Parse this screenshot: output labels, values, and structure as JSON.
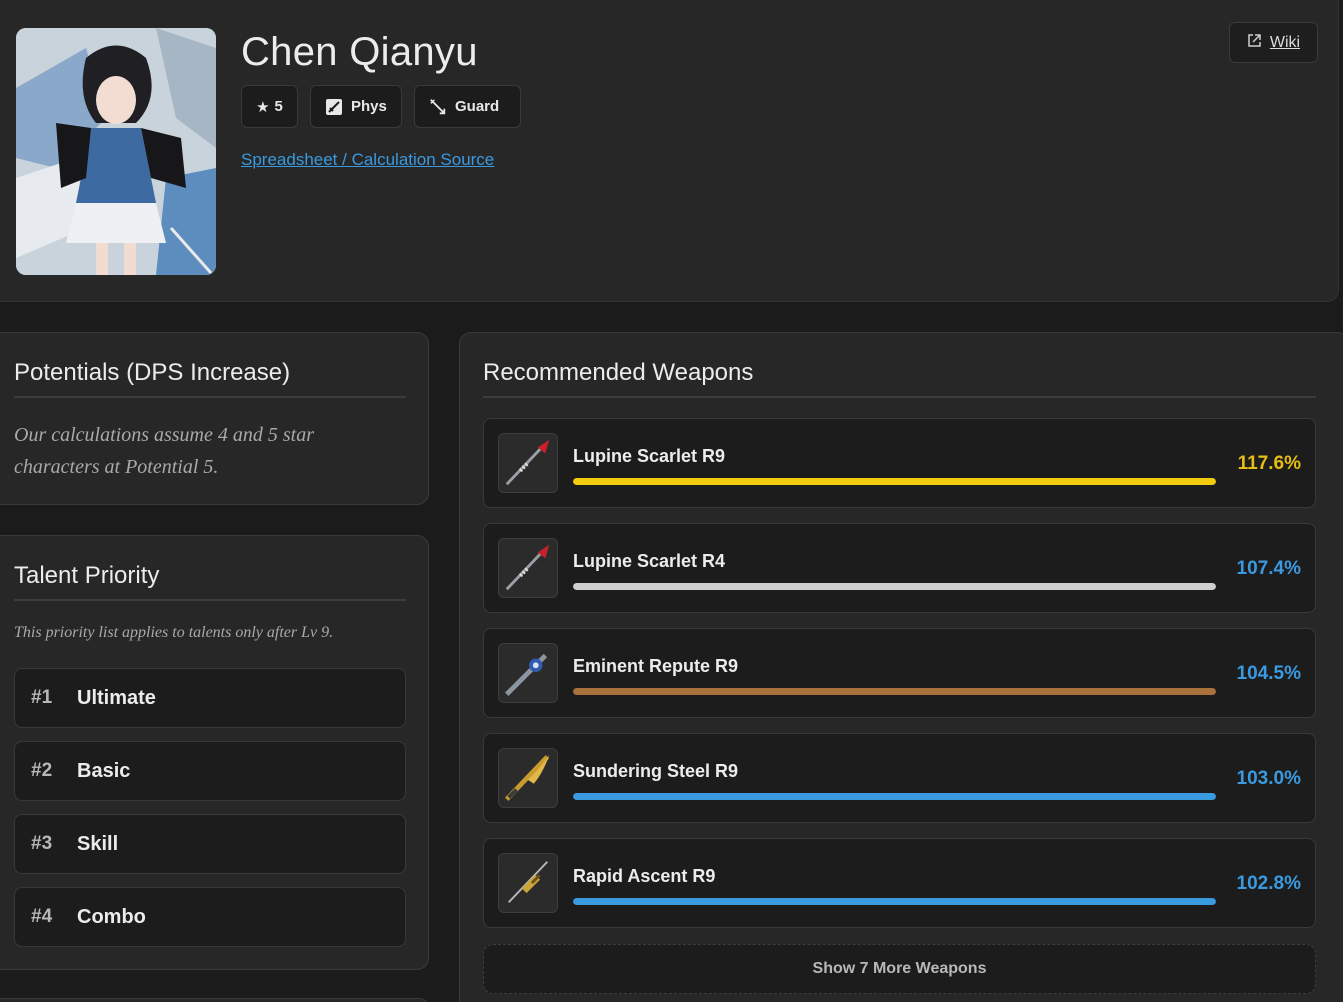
{
  "character": {
    "name": "Chen Qianyu",
    "rarity": "5",
    "element": "Phys",
    "class": "Guard",
    "source_link": "Spreadsheet / Calculation Source",
    "wiki_label": "Wiki"
  },
  "potentials": {
    "title": "Potentials (DPS Increase)",
    "note": "Our calculations assume 4 and 5 star characters at Potential 5."
  },
  "talents": {
    "title": "Talent Priority",
    "note": "This priority list applies to talents only after Lv 9.",
    "items": [
      {
        "rank": "#1",
        "name": "Ultimate"
      },
      {
        "rank": "#2",
        "name": "Basic"
      },
      {
        "rank": "#3",
        "name": "Skill"
      },
      {
        "rank": "#4",
        "name": "Combo"
      }
    ]
  },
  "weapons": {
    "title": "Recommended Weapons",
    "items": [
      {
        "name": "Lupine Scarlet R9",
        "pct": "117.6%",
        "value": 117.6,
        "bar_color": "#f2cc0f",
        "pct_color": "#e6bd12",
        "icon": "lupine-scarlet-icon"
      },
      {
        "name": "Lupine Scarlet R4",
        "pct": "107.4%",
        "value": 107.4,
        "bar_color": "#cfcfcf",
        "pct_color": "#3a9ae0",
        "icon": "lupine-scarlet-icon"
      },
      {
        "name": "Eminent Repute R9",
        "pct": "104.5%",
        "value": 104.5,
        "bar_color": "#a9713c",
        "pct_color": "#3a9ae0",
        "icon": "eminent-repute-icon"
      },
      {
        "name": "Sundering Steel R9",
        "pct": "103.0%",
        "value": 103.0,
        "bar_color": "#3a9ae0",
        "pct_color": "#3a9ae0",
        "icon": "sundering-steel-icon"
      },
      {
        "name": "Rapid Ascent R9",
        "pct": "102.8%",
        "value": 102.8,
        "bar_color": "#3a9ae0",
        "pct_color": "#3a9ae0",
        "icon": "rapid-ascent-icon"
      }
    ],
    "more_label": "Show 7 More Weapons"
  }
}
